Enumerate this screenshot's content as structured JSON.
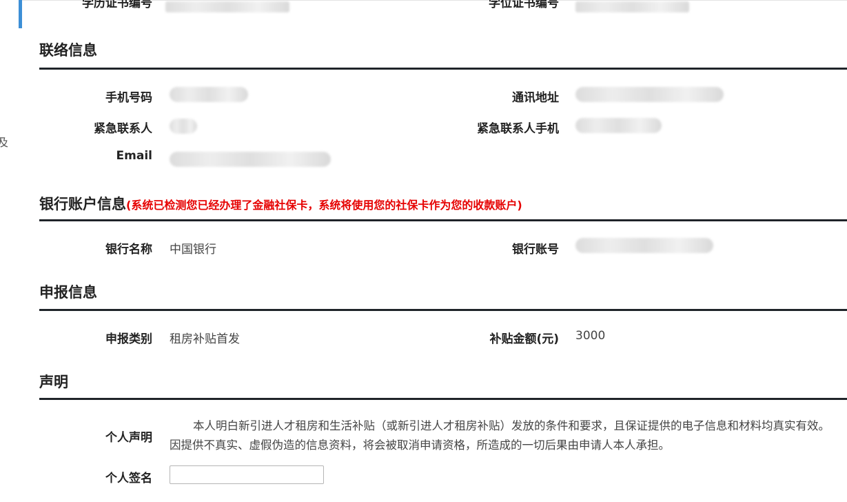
{
  "partial_top": {
    "left_label": "学历证书编号",
    "right_label": "学位证书编号"
  },
  "sections": {
    "contact": {
      "title": "联络信息",
      "fields": {
        "phone_label": "手机号码",
        "address_label": "通讯地址",
        "emergency_contact_label": "紧急联系人",
        "emergency_phone_label": "紧急联系人手机",
        "email_label": "Email"
      }
    },
    "bank": {
      "title": "银行账户信息",
      "note": "(系统已检测您已经办理了金融社保卡，系统将使用您的社保卡作为您的收款账户)",
      "fields": {
        "bank_name_label": "银行名称",
        "bank_name_value": "中国银行",
        "account_label": "银行账号"
      }
    },
    "application": {
      "title": "申报信息",
      "fields": {
        "type_label": "申报类别",
        "type_value": "租房补贴首发",
        "amount_label": "补贴金额(元)",
        "amount_value": "3000"
      }
    },
    "declaration": {
      "title": "声明",
      "statement_label": "个人声明",
      "statement_text": "本人明白新引进人才租房和生活补贴（或新引进人才租房补贴）发放的条件和要求，且保证提供的电子信息和材料均真实有效。因提供不真实、虚假伪造的信息资料，将会被取消申请资格，所造成的一切后果由申请人本人承担。",
      "signature_label": "个人签名",
      "signature_value": ""
    }
  },
  "colors": {
    "accent_bar": "#3d8fd6",
    "note_red": "#e60000",
    "rule": "#1f2429"
  }
}
